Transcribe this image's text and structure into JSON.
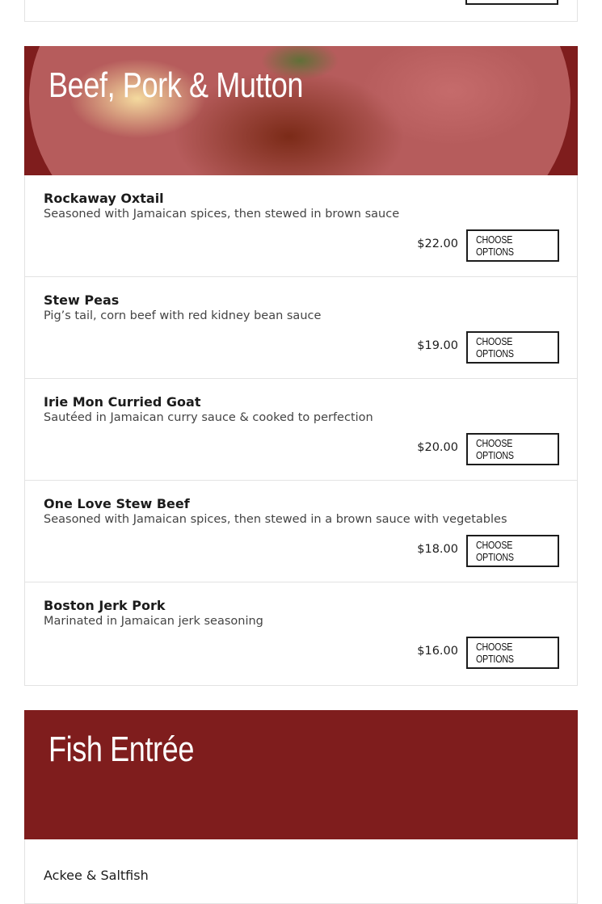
{
  "sections": {
    "beef": {
      "title": "Beef, Pork & Mutton",
      "items": [
        {
          "name": "Rockaway Oxtail",
          "description": "Seasoned with Jamaican spices, then stewed in brown sauce",
          "price": "$22.00",
          "button": "CHOOSE OPTIONS"
        },
        {
          "name": "Stew Peas",
          "description": "Pig’s tail, corn beef with red kidney bean sauce",
          "price": "$19.00",
          "button": "CHOOSE OPTIONS"
        },
        {
          "name": "Irie Mon Curried Goat",
          "description": "Sautéed in Jamaican curry sauce & cooked to perfection",
          "price": "$20.00",
          "button": "CHOOSE OPTIONS"
        },
        {
          "name": "One Love Stew Beef",
          "description": "Seasoned with Jamaican spices, then stewed in a brown sauce with vegetables",
          "price": "$18.00",
          "button": "CHOOSE OPTIONS"
        },
        {
          "name": "Boston Jerk Pork",
          "description": "Marinated in Jamaican jerk seasoning",
          "price": "$16.00",
          "button": "CHOOSE OPTIONS"
        }
      ]
    },
    "fish": {
      "title": "Fish Entrée",
      "first_item": "Ackee & Saltfish"
    }
  },
  "colors": {
    "banner": "#7f1d1d",
    "border": "#e3e3e3",
    "button_border": "#1c1c1c"
  }
}
